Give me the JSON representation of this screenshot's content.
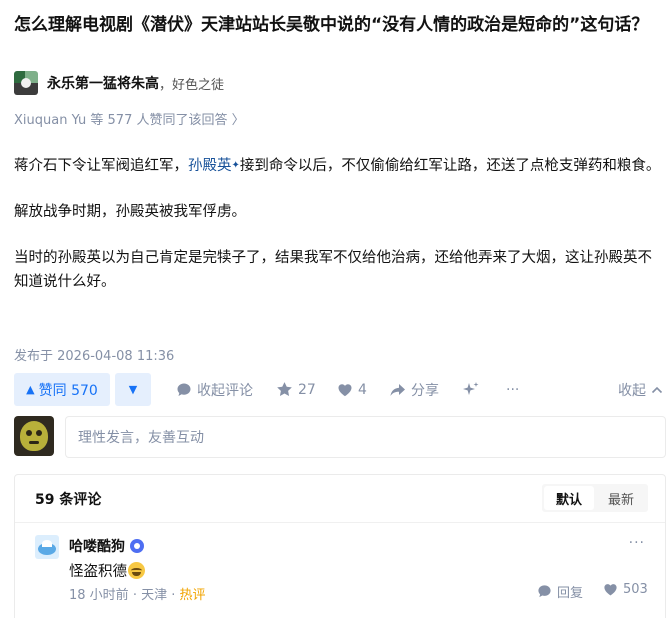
{
  "question": {
    "title": "怎么理解电视剧《潜伏》天津站站长吴敬中说的“没有人情的政治是短命的”这句话？"
  },
  "author": {
    "name": "永乐第一猛将朱高",
    "bio": "，好色之徒"
  },
  "upvoters_text": "Xiuquan Yu 等 577 人赞同了该回答 〉",
  "content": {
    "p1_before": "蒋介石下令让军阀追红军，",
    "p1_link": "孙殿英",
    "p1_after": "接到命令以后，不仅偷偷给红军让路，还送了点枪支弹药和粮食。",
    "p2": "解放战争时期，孙殿英被我军俘虏。",
    "p3": "当时的孙殿英以为自己肯定是完犊子了，结果我军不仅给他治病，还给他弄来了大烟，这让孙殿英不知道说什么好。"
  },
  "published": "发布于 2026-04-08 11:36",
  "actions": {
    "upvote_label": "赞同 570",
    "comments_label": "收起评论",
    "favorites_count": "27",
    "likes_count": "4",
    "share_label": "分享",
    "more_label": "···",
    "collapse_label": "收起"
  },
  "comment_input": {
    "placeholder": "理性发言，友善互动"
  },
  "comments": {
    "count_label": "59 条评论",
    "sort_default": "默认",
    "sort_latest": "最新",
    "items": [
      {
        "name": "哈喽酷狗",
        "text": "怪盗积德",
        "time": "18 小时前",
        "location": "天津",
        "tag": "热评",
        "reply_label": "回复",
        "likes": "503",
        "more_label": "···"
      }
    ]
  },
  "colors": {
    "brand_blue": "#1772f6",
    "vote_bg": "#e5effd",
    "meta_gray": "#8590a6",
    "link_blue": "#175199",
    "hot_orange": "#f1a400"
  }
}
